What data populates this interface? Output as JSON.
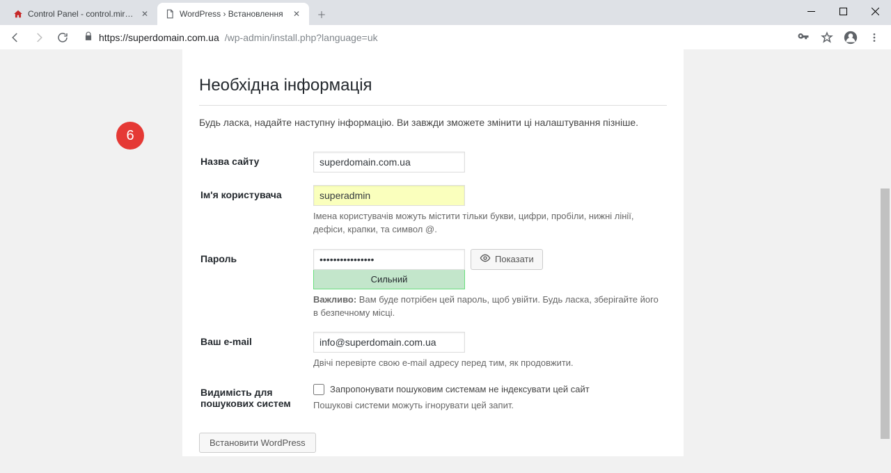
{
  "browser": {
    "tabs": [
      {
        "title": "Control Panel - control.mirohost.",
        "favicon": "house"
      },
      {
        "title": "WordPress › Встановлення",
        "favicon": "page"
      }
    ],
    "url_host": "https://superdomain.com.ua",
    "url_path": "/wp-admin/install.php?language=uk"
  },
  "badge": "6",
  "heading": "Необхідна інформація",
  "intro": "Будь ласка, надайте наступну інформацію. Ви завжди зможете змінити ці налаштування пізніше.",
  "labels": {
    "site_title": "Назва сайту",
    "username": "Ім'я користувача",
    "password": "Пароль",
    "email": "Ваш e-mail",
    "visibility": "Видимість для пошукових систем"
  },
  "values": {
    "site_title": "superdomain.com.ua",
    "username": "superadmin",
    "password": "••••••••••••••••",
    "email": "info@superdomain.com.ua"
  },
  "hints": {
    "username": "Імена користувачів можуть містити тільки букви, цифри, пробіли, нижні лінії, дефіси, крапки, та символ @.",
    "password_strength": "Сильний",
    "password_important_label": "Важливо:",
    "password_important": " Вам буде потрібен цей пароль, щоб увійти. Будь ласка, зберігайте його в безпечному місці.",
    "email": "Двічі перевірте свою e-mail адресу перед тим, як продовжити.",
    "visibility_checkbox": "Запропонувати пошуковим системам не індексувати цей сайт",
    "visibility_note": "Пошукові системи можуть ігнорувати цей запит."
  },
  "buttons": {
    "show_password": "Показати",
    "install": "Встановити WordPress"
  }
}
